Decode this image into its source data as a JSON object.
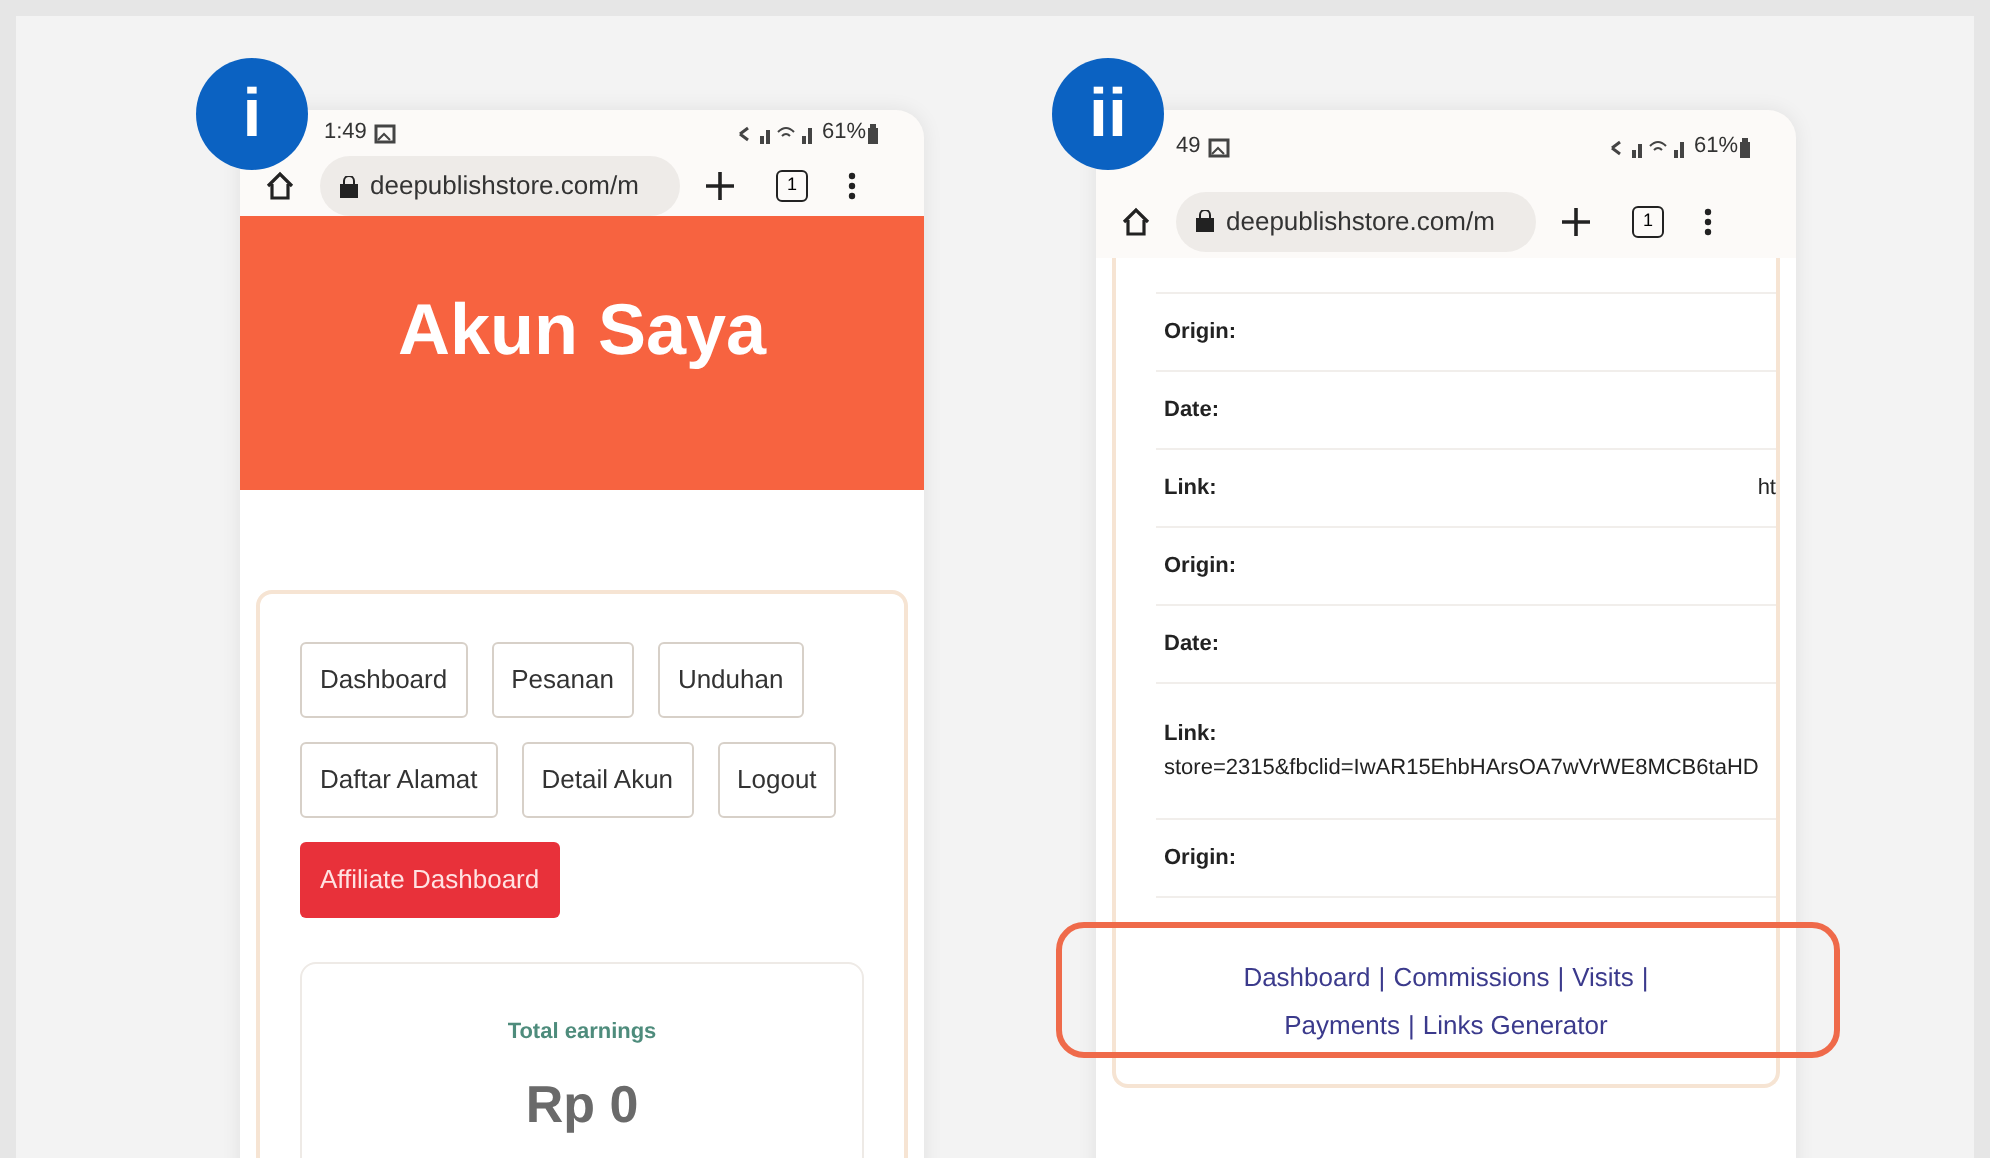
{
  "phones": [
    {
      "badge": "i",
      "status": {
        "time": "1:49",
        "battery": "61%"
      },
      "url_bar": {
        "url": "deepublishstore.com/m",
        "tab_count": "1"
      },
      "header": {
        "title": "Akun Saya"
      },
      "account_buttons": [
        {
          "label": "Dashboard",
          "selected": false
        },
        {
          "label": "Pesanan",
          "selected": false
        },
        {
          "label": "Unduhan",
          "selected": false
        },
        {
          "label": "Daftar Alamat",
          "selected": false
        },
        {
          "label": "Detail Akun",
          "selected": false
        },
        {
          "label": "Logout",
          "selected": false
        },
        {
          "label": "Affiliate Dashboard",
          "selected": true
        }
      ],
      "earnings": {
        "label": "Total earnings",
        "value": "Rp 0"
      }
    },
    {
      "badge": "ii",
      "status": {
        "time": "49",
        "battery": "61%"
      },
      "url_bar": {
        "url": "deepublishstore.com/m",
        "tab_count": "1"
      },
      "details": [
        {
          "kind": "inline",
          "label": "Origin:"
        },
        {
          "kind": "inline",
          "label": "Date:"
        },
        {
          "kind": "inline",
          "label": "Link:",
          "value": "ht"
        },
        {
          "kind": "inline",
          "label": "Origin:"
        },
        {
          "kind": "inline",
          "label": "Date:"
        },
        {
          "kind": "below",
          "label": "Link:",
          "value": "store=2315&fbclid=IwAR15EhbHArsOA7wVrWE8MCB6taHD"
        },
        {
          "kind": "inline",
          "label": "Origin:"
        }
      ],
      "affiliate_nav": {
        "separator": "|",
        "highlighted": true,
        "lines": [
          [
            "Dashboard",
            "Commissions",
            "Visits"
          ],
          [
            "Payments",
            "Links Generator"
          ]
        ]
      }
    }
  ]
}
